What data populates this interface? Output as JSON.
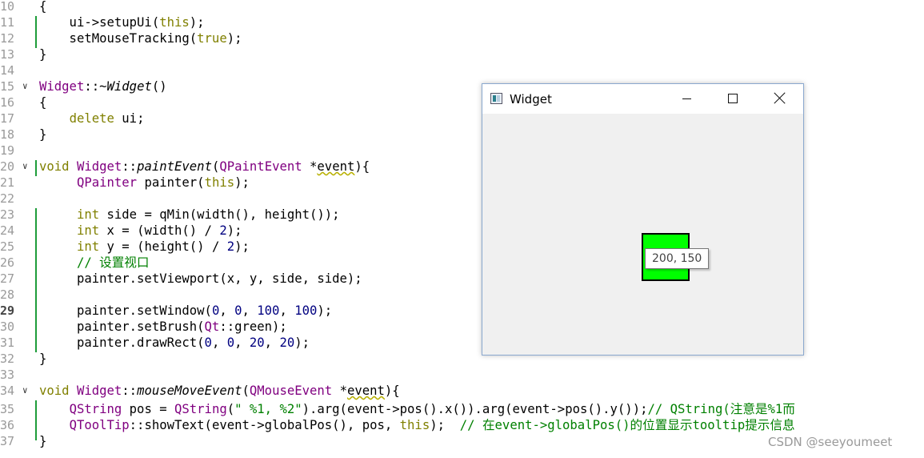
{
  "editor": {
    "lines": [
      {
        "n": "10",
        "code": "{"
      },
      {
        "n": "11",
        "code": "    ui->setupUi(this);"
      },
      {
        "n": "12",
        "code": "    setMouseTracking(true);"
      },
      {
        "n": "13",
        "code": "}"
      },
      {
        "n": "14",
        "code": ""
      },
      {
        "n": "15",
        "code": "Widget::~Widget()"
      },
      {
        "n": "16",
        "code": "{"
      },
      {
        "n": "17",
        "code": "    delete ui;"
      },
      {
        "n": "18",
        "code": "}"
      },
      {
        "n": "19",
        "code": ""
      },
      {
        "n": "20",
        "code": "void Widget::paintEvent(QPaintEvent *event){"
      },
      {
        "n": "21",
        "code": "     QPainter painter(this);"
      },
      {
        "n": "22",
        "code": ""
      },
      {
        "n": "23",
        "code": "     int side = qMin(width(), height());"
      },
      {
        "n": "24",
        "code": "     int x = (width() / 2);"
      },
      {
        "n": "25",
        "code": "     int y = (height() / 2);"
      },
      {
        "n": "26",
        "code": "     // 设置视口"
      },
      {
        "n": "27",
        "code": "     painter.setViewport(x, y, side, side);"
      },
      {
        "n": "28",
        "code": ""
      },
      {
        "n": "29",
        "code": "     painter.setWindow(0, 0, 100, 100);"
      },
      {
        "n": "30",
        "code": "     painter.setBrush(Qt::green);"
      },
      {
        "n": "31",
        "code": "     painter.drawRect(0, 0, 20, 20);"
      },
      {
        "n": "32",
        "code": "}"
      },
      {
        "n": "33",
        "code": ""
      },
      {
        "n": "34",
        "code": "void Widget::mouseMoveEvent(QMouseEvent *event){"
      },
      {
        "n": "35",
        "code": "    QString pos = QString(\" %1, %2\").arg(event->pos().x()).arg(event->pos().y());// QString(注意是%1而"
      },
      {
        "n": "36",
        "code": "    QToolTip::showText(event->globalPos(), pos, this);  // 在event->globalPos()的位置显示tooltip提示信息"
      },
      {
        "n": "37",
        "code": "}"
      }
    ],
    "fold_markers": [
      "15",
      "20",
      "34"
    ],
    "current_line": "29"
  },
  "window": {
    "title": "Widget",
    "icon": "app-window-icon",
    "minimize_icon": "minimize-icon",
    "maximize_icon": "maximize-icon",
    "close_icon": "close-icon",
    "rect_color": "#00ff00",
    "tooltip_text": "200, 150"
  },
  "watermark": "CSDN @seeyoumeet"
}
